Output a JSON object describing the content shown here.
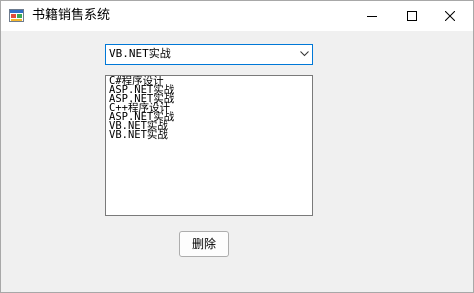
{
  "window": {
    "title": "书籍销售系统",
    "app_icon": "app-icon",
    "controls": {
      "minimize_icon": "minimize-icon",
      "maximize_icon": "maximize-icon",
      "close_icon": "close-icon"
    }
  },
  "combo": {
    "selected": "VB.NET实战",
    "dropdown_icon": "chevron-down-icon"
  },
  "listbox": {
    "items": [
      "C#程序设计",
      "ASP.NET实战",
      "ASP.NET实战",
      "C++程序设计",
      "ASP.NET实战",
      "VB.NET实战",
      "VB.NET实战"
    ]
  },
  "delete_button": {
    "label": "删除"
  },
  "colors": {
    "window_bg": "#f0f0f0",
    "titlebar_bg": "#ffffff",
    "combo_border": "#0078d7",
    "list_border": "#7a7a7a",
    "button_border": "#adadad"
  }
}
